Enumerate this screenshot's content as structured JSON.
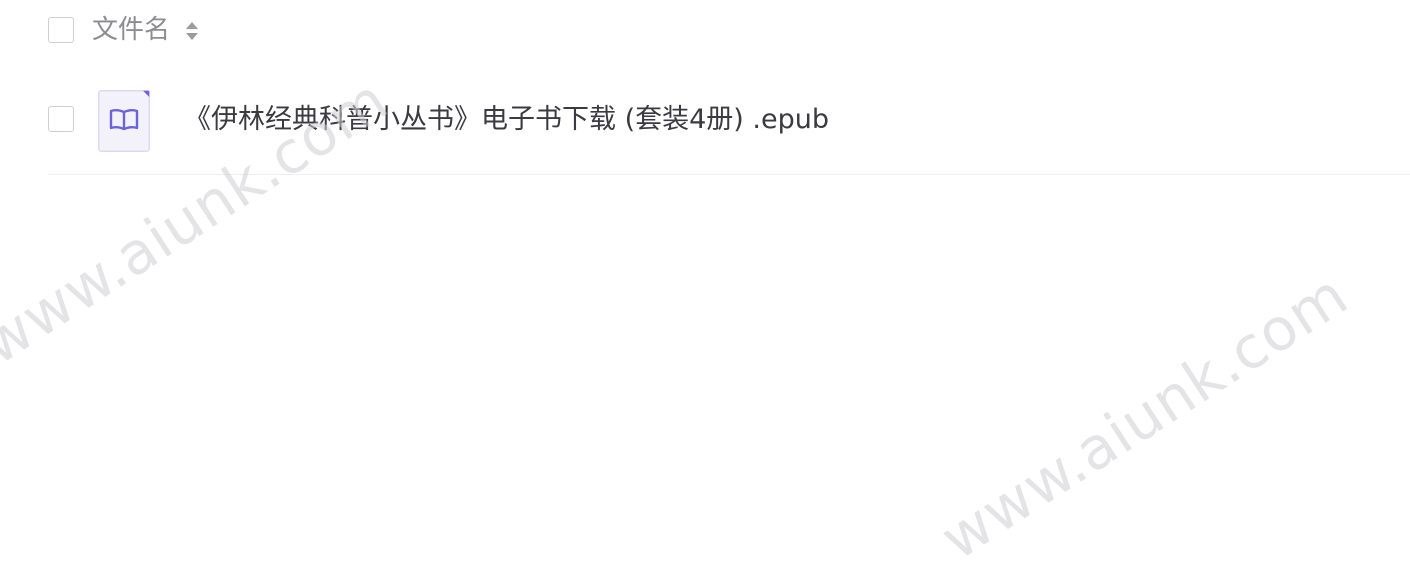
{
  "header": {
    "column_label": "文件名"
  },
  "files": [
    {
      "name": "《伊林经典科普小丛书》电子书下载 (套装4册) .epub",
      "icon": "book-icon"
    }
  ],
  "watermark": "www.aiunk.com",
  "colors": {
    "icon_accent": "#6b63d9",
    "icon_bg": "#f3f2fb"
  }
}
